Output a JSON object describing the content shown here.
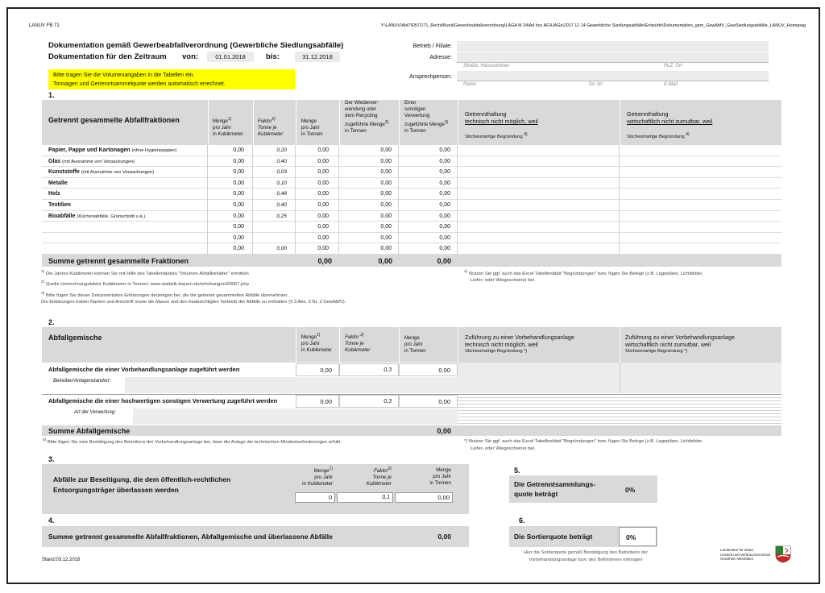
{
  "top_left_code": "LANUV FB 71",
  "file_path": "Y:\\LANUV\\Abt7\\FB71\\71_Recht\\Bund\\Gewerbeabfallverordnung\\LAGA M 34\\Ad hoc AG\\UAGs\\2017 12 14 Gewerbliche Siedlungsabfälle\\Entwürfe\\Dokumentation_gem_GewAbfV_GewSiedlungsabfälle_LANUV_Homepag",
  "title1": "Dokumentation gemäß Gewerbeabfallverordnung (Gewerbliche Siedlungsabfälle)",
  "title2": "Dokumentation für den Zeitraum",
  "von_label": "von:",
  "von_value": "01.01.2018",
  "bis_label": "bis:",
  "bis_value": "31.12.2018",
  "notice_line1": "Bitte tragen Sie die Volumenangaben in die Tabellen ein.",
  "notice_line2": "Tonnagen und Getrenntsammelquote werden automatisch errechnet.",
  "right_header": {
    "betrieb_label": "Betrieb / Filiale:",
    "adresse_label": "Adresse:",
    "strasse_hint": "Straße, Hausnummer",
    "plz_hint": "PLZ, Ort",
    "ansprech_label": "Ansprechperson:",
    "name_hint": "Name",
    "tel_hint": "Tel. Nr.",
    "email_hint": "E-Mail"
  },
  "section1": {
    "number": "1.",
    "heading": "Getrennt gesammelte Abfallfraktionen",
    "col_menge": "Menge",
    "col_menge_sup": "1)",
    "col_menge_sub1": "pro Jahr",
    "col_menge_sub2": "in Kubikmeter",
    "col_faktor": "Faktor",
    "col_faktor_sup": "2)",
    "col_faktor_sub1": "Tonne je",
    "col_faktor_sub2": "Kubikmeter",
    "col_menge_t": "Menge",
    "col_menge_t_sub1": "pro Jahr",
    "col_menge_t_sub2": "in Tonnen",
    "col_wv_1": "Der Wiederver-",
    "col_wv_2": "wendung oder",
    "col_wv_3": "dem Recycling",
    "col_wv_4": "zugeführte Menge",
    "col_wv_sup": "3)",
    "col_wv_5": "in Tonnen",
    "col_sv_1": "Einer",
    "col_sv_2": "sonstigen",
    "col_sv_3": "Verwertung",
    "col_sv_4": "zugeführte Menge",
    "col_sv_sup": "3)",
    "col_sv_5": "in Tonnen",
    "col_gt1_1": "Getrennthaltung",
    "col_gt1_2": "technisch nicht möglich, weil",
    "col_gt1_sub": "Stichwortartige Begründung",
    "col_gt1_sup": "4)",
    "col_gt2_1": "Getrennthaltung",
    "col_gt2_2": "wirtschaftlich nicht zumutbar, weil",
    "col_gt2_sub": "Stichwortartige Begründung",
    "col_gt2_sup": "4)",
    "rows": [
      {
        "name": "Papier, Pappe und Kartonagen",
        "note": "(ohne Hygienepapier)",
        "menge": "0,00",
        "faktor": "0,20",
        "tonnen": "0,00",
        "wv": "0,00",
        "sv": "0,00"
      },
      {
        "name": "Glas",
        "note": "(mit Ausnahme von Verpackungen)",
        "menge": "0,00",
        "faktor": "0,40",
        "tonnen": "0,00",
        "wv": "0,00",
        "sv": "0,00"
      },
      {
        "name": "Kunststoffe",
        "note": "(mit Ausnahme von Verpackungen)",
        "menge": "0,00",
        "faktor": "0,03",
        "tonnen": "0,00",
        "wv": "0,00",
        "sv": "0,00"
      },
      {
        "name": "Metalle",
        "note": "",
        "menge": "0,00",
        "faktor": "0,10",
        "tonnen": "0,00",
        "wv": "0,00",
        "sv": "0,00"
      },
      {
        "name": "Holz",
        "note": "",
        "menge": "0,00",
        "faktor": "0,48",
        "tonnen": "0,00",
        "wv": "0,00",
        "sv": "0,00"
      },
      {
        "name": "Textilien",
        "note": "",
        "menge": "0,00",
        "faktor": "0,40",
        "tonnen": "0,00",
        "wv": "0,00",
        "sv": "0,00"
      },
      {
        "name": "Bioabfälle",
        "note": "(Küchenabfälle, Grünschnitt u.ä.)",
        "menge": "0,00",
        "faktor": "0,25",
        "tonnen": "0,00",
        "wv": "0,00",
        "sv": "0,00"
      },
      {
        "name": "",
        "note": "",
        "menge": "0,00",
        "faktor": "",
        "tonnen": "0,00",
        "wv": "0,00",
        "sv": "0,00"
      },
      {
        "name": "",
        "note": "",
        "menge": "0,00",
        "faktor": "",
        "tonnen": "0,00",
        "wv": "0,00",
        "sv": "0,00"
      },
      {
        "name": "",
        "note": "",
        "menge": "0,00",
        "faktor": "0,00",
        "tonnen": "0,00",
        "wv": "0,00",
        "sv": "0,00"
      }
    ],
    "sum_label": "Summe getrennt gesammelte Fraktionen",
    "sum_tonnen": "0,00",
    "sum_wv": "0,00",
    "sum_sv": "0,00",
    "fn1_sup": "1)",
    "fn1": "Die Jahres Kubikmeter können Sie mit Hilfe des Tabellenblattes \"Volumen Abfallbehälter\" ermitteln",
    "fn2_sup": "2)",
    "fn2": "Quelle Umrechnungsfaktor Kubikmeter in Tonnen: www.statistik.bayern.de/erhebungen/00067.php",
    "fn3_sup": "3)",
    "fn3a": "Bitte fügen Sie dieser Dokumentation Erklärungen derjenigen bei, die die getrennt gesammelten Abfälle übernehmen.",
    "fn3b": "Die Erklärungen haben Namen und Anschrift sowie die Masse und den beabsichtigten Verbleib der Abfälle zu enthalten (§ 3 Abs. 3 Nr. 2 GewAbfV).",
    "fn4_sup": "4)",
    "fn4a": "Nutzen Sie ggf. auch das Excel Tabellenblatt \"Begründungen\" bzw. fügen Sie Belege (z.B. Lagepläne, Lichtbilder,",
    "fn4b": "Liefer- oder Wiegescheine) bei."
  },
  "section2": {
    "number": "2.",
    "heading": "Abfallgemische",
    "col_menge": "Menge",
    "col_menge_sup": "1)",
    "col_menge_sub1": "pro Jahr",
    "col_menge_sub2": "in Kubikmeter",
    "col_faktor": "Faktor",
    "col_faktor_sup": "2)",
    "col_faktor_sub1": "Tonne je",
    "col_faktor_sub2": "Kubikmeter",
    "col_menge_t": "Menge",
    "col_menge_t_sub1": "pro Jahr",
    "col_menge_t_sub2": "in Tonnen",
    "col_v1_1": "Zuführung zu einer Vorbehandlungsanlage",
    "col_v1_2": "technisch nicht möglich, weil",
    "col_v1_sub": "Stichwortartige Begründung *)",
    "col_v2_1": "Zuführung  zu einer Vorbehandlungsanlage",
    "col_v2_2": "wirtschaftlich nicht zumutbar, weil",
    "col_v2_sub": "Stichwortartige Begründung *)",
    "row1_label": "Abfallgemische die einer Vorbehandlungsanlage zugeführt werden",
    "row1_menge": "0,00",
    "row1_faktor": "0,3",
    "row1_tonnen": "0,00",
    "row1_sub_label": "Betreiber/Anlagenstandort:",
    "row2_label": "Abfallgemische die einer hochwertigen sonstigen Verwertung zugeführt werden",
    "row2_menge": "0,00",
    "row2_faktor": "0,3",
    "row2_tonnen": "0,00",
    "row2_sub_label": "Art der Verwertung:",
    "sum_label": "Summe Abfallgemische",
    "sum_tonnen": "0,00",
    "fn5_sup": "5)",
    "fn5": "Bitte fügen Sie eine Bestätigung des Betreibers der Vorbehandlungsanlage bei, dass die Anlage die technischen Mindestanforderungen erfüllt.",
    "fnstar": "*) Nutzen Sie ggf. auch das Excel Tabellenblatt \"Begründungen\" bzw. fügen Sie Belege (z.B. Lagepläne, Lichtbilder,",
    "fnstar2": "Liefer- oder Wiegescheine) bei."
  },
  "section3": {
    "number": "3.",
    "label1": "Abfälle zur Beseitigung, die dem öffentlich-rechtlichen",
    "label2": "Entsorgungsträger überlassen werden",
    "col_menge": "Menge",
    "col_menge_sup": "1)",
    "col_menge_sub1": "pro Jahr",
    "col_menge_sub2": "in Kubikmeter",
    "col_faktor": "Faktor",
    "col_faktor_sup": "2)",
    "col_faktor_sub1": "Tonne je",
    "col_faktor_sub2": "Kubikmeter",
    "col_menge_t": "Menge",
    "col_menge_t_sub1": "pro Jahr",
    "col_menge_t_sub2": "in Tonnen",
    "menge": "0",
    "faktor": "0,1",
    "tonnen": "0,00"
  },
  "section4": {
    "number": "4.",
    "label": "Summe getrennt gesammelte Abfallfraktionen, Abfallgemische und überlassene Abfälle",
    "value": "0,00"
  },
  "section5": {
    "number": "5.",
    "label1": "Die Getrenntsammlungs-",
    "label2": "quote beträgt",
    "value": "0%"
  },
  "section6": {
    "number": "6.",
    "label": "Die Sortierquote beträgt",
    "value": "0%",
    "note1": "Hier die Sortierquote gemäß Bestätigung des Betreibers der",
    "note2": "Vorbehandlungsanlage bzw. des Beförderers eintragen"
  },
  "logo_text": {
    "line1": "Landesamt für Natur,",
    "line2": "Umwelt und Verbraucherschutz",
    "line3": "Nordrhein-Westfalen"
  },
  "stand": "Stand:03.12.2018"
}
